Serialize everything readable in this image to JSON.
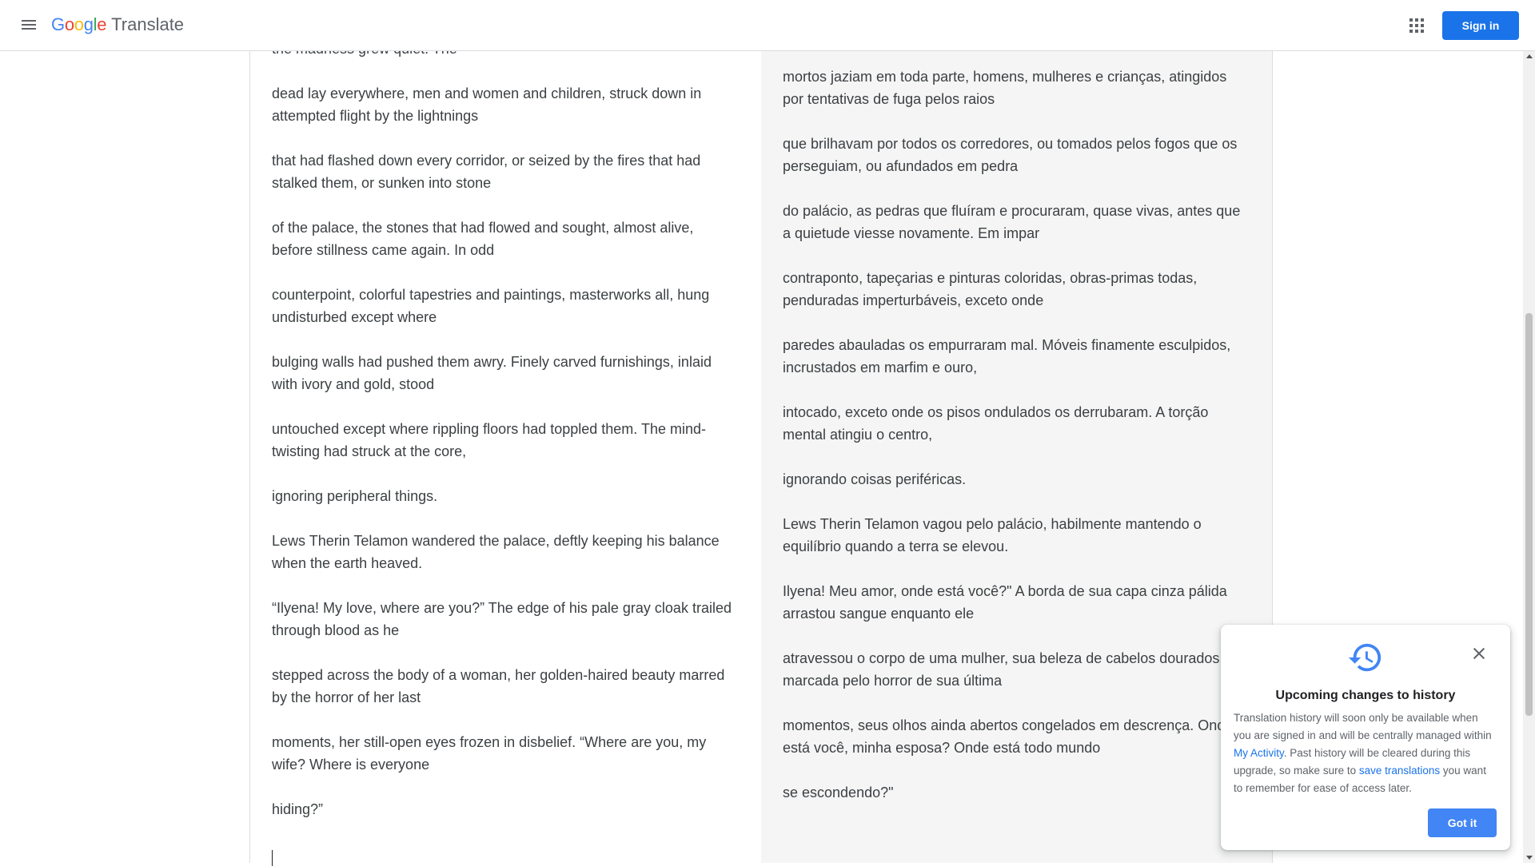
{
  "header": {
    "logo_letters": [
      {
        "char": "G",
        "color": "#4285f4"
      },
      {
        "char": "o",
        "color": "#ea4335"
      },
      {
        "char": "o",
        "color": "#fbbc05"
      },
      {
        "char": "g",
        "color": "#4285f4"
      },
      {
        "char": "l",
        "color": "#34a853"
      },
      {
        "char": "e",
        "color": "#ea4335"
      }
    ],
    "product": "Translate",
    "sign_in_label": "Sign in",
    "menu_icon": "hamburger-menu-icon",
    "apps_icon": "apps-grid-icon"
  },
  "source": {
    "paragraphs": [
      "the madness grew quiet. The",
      "dead lay everywhere, men and women and children, struck down in attempted flight by the lightnings",
      "that had flashed down every corridor, or seized by the fires that had stalked them, or sunken into stone",
      "of the palace, the stones that had flowed and sought, almost alive, before stillness came again. In odd",
      "counterpoint, colorful tapestries and paintings, masterworks all, hung undisturbed except where",
      "bulging walls had pushed them awry. Finely carved furnishings, inlaid with ivory and gold, stood",
      "untouched except where rippling floors had toppled them. The mind-twisting had struck at the core,",
      "ignoring peripheral things.",
      "Lews Therin Telamon wandered the palace, deftly keeping his balance when the earth heaved.",
      "“Ilyena! My love, where are you?” The edge of his pale gray cloak trailed through blood as he",
      "stepped across the body of a woman, her golden-haired beauty marred by the horror of her last",
      "moments, her still-open eyes frozen in disbelief. “Where are you, my wife? Where is everyone",
      "hiding?”"
    ]
  },
  "target": {
    "paragraphs": [
      "mortos jaziam em toda parte, homens, mulheres e crianças, atingidos por tentativas de fuga pelos raios",
      "que brilhavam por todos os corredores, ou tomados pelos fogos que os perseguiam, ou afundados em pedra",
      "do palácio, as pedras que fluíram e procuraram, quase vivas, antes que a quietude viesse novamente. Em impar",
      "contraponto, tapeçarias e pinturas coloridas, obras-primas todas, penduradas imperturbáveis, exceto onde",
      "paredes abauladas os empurraram mal. Móveis finamente esculpidos, incrustados em marfim e ouro,",
      "intocado, exceto onde os pisos ondulados os derrubaram. A torção mental atingiu o centro,",
      "ignorando coisas periféricas.",
      "Lews Therin Telamon vagou pelo palácio, habilmente mantendo o equilíbrio quando a terra se elevou.",
      "Ilyena! Meu amor, onde está você?\" A borda de sua capa cinza pálida arrastou sangue enquanto ele",
      "atravessou o corpo de uma mulher, sua beleza de cabelos dourados marcada pelo horror de sua última",
      "momentos, seus olhos ainda abertos congelados em descrença. Onde está você, minha esposa? Onde está todo mundo",
      "se escondendo?\""
    ]
  },
  "popup": {
    "icon": "history-icon",
    "title": "Upcoming changes to history",
    "body_1": "Translation history will soon only be available when you are signed in and will be centrally managed within ",
    "link_activity": "My Activity",
    "body_2": ". Past history will be cleared during this upgrade, so make sure to ",
    "link_save": "save translations",
    "body_3": " you want to remember for ease of access later.",
    "got_it_label": "Got it",
    "close_icon": "close-icon"
  },
  "colors": {
    "accent": "#1a73e8",
    "button_blue": "#4285f4",
    "target_bg": "#f5f5f5"
  }
}
